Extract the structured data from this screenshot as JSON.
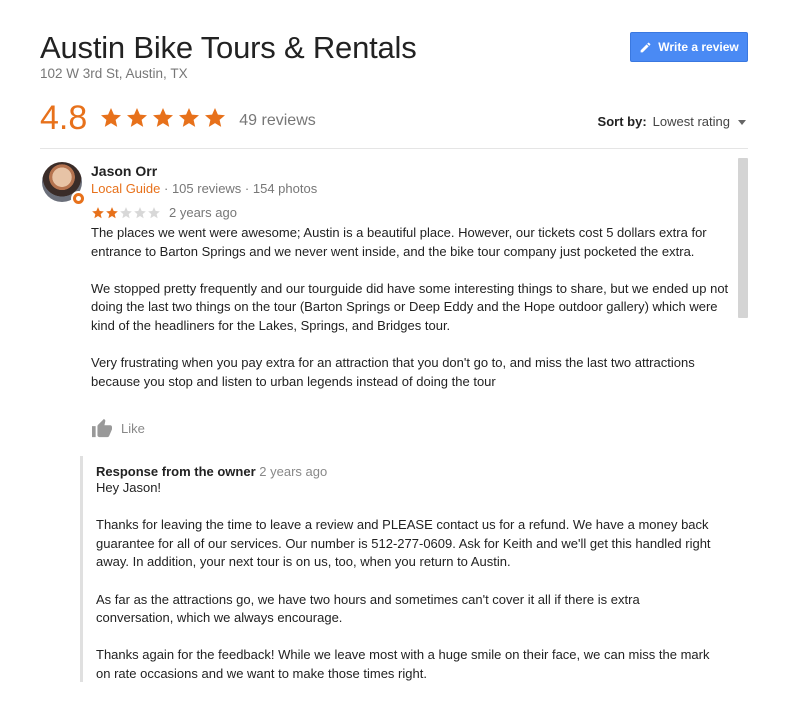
{
  "business": {
    "name": "Austin Bike Tours & Rentals",
    "address": "102 W 3rd St, Austin, TX"
  },
  "write_review_label": "Write a review",
  "rating": {
    "value": "4.8",
    "stars": 5,
    "review_count": "49 reviews"
  },
  "sort": {
    "label": "Sort by:",
    "value": "Lowest rating"
  },
  "colors": {
    "accent_orange": "#e7711b",
    "button_blue": "#4a8af4",
    "muted_gray": "#777777"
  },
  "review": {
    "author": "Jason Orr",
    "guide_label": "Local Guide",
    "meta": " · 105 reviews · 154 photos",
    "rating": 2,
    "date": "2 years ago",
    "paragraphs": [
      "The places we went were awesome; Austin is a beautiful place. However, our tickets cost 5 dollars extra for entrance to Barton Springs and we never went inside, and the bike tour company just pocketed the extra.",
      "We stopped pretty frequently and our tourguide did have some interesting things to share, but we ended up not doing the last two things on the tour (Barton Springs or Deep Eddy and the Hope outdoor gallery) which were kind of the headliners for the Lakes, Springs, and Bridges tour.",
      "Very frustrating when you pay extra for an attraction that you don't go to, and miss the last two attractions because you stop and listen to urban legends instead of doing the tour"
    ],
    "like_label": "Like"
  },
  "owner_response": {
    "label": "Response from the owner",
    "date": "2 years ago",
    "paragraphs": [
      "Hey Jason!",
      "Thanks for leaving the time to leave a review and PLEASE contact us for a refund. We have a money back guarantee for all of our services. Our number is 512-277-0609. Ask for Keith and we'll get this handled right away. In addition, your next tour is on us, too, when you return to Austin.",
      "As far as the attractions go, we have two hours and sometimes can't cover it all if there is extra conversation, which we always encourage.",
      "Thanks again for the feedback! While we leave most with a huge smile on their face, we can miss the mark on rate occasions and we want to make those times right."
    ]
  }
}
